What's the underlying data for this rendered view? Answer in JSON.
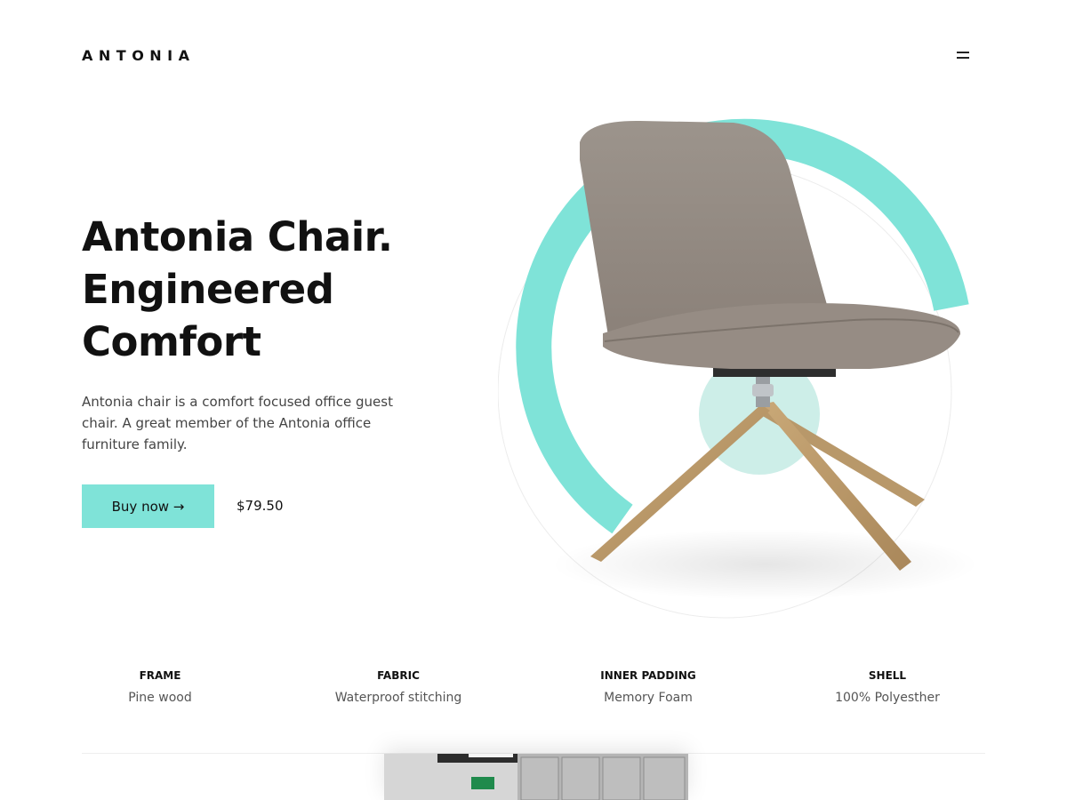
{
  "header": {
    "logo": "ANTONIA",
    "menu_icon": "hamburger-icon"
  },
  "hero": {
    "headline": [
      "Antonia Chair.",
      "Engineered",
      "Comfort"
    ],
    "description": "Antonia chair is a comfort focused office guest chair. A great member of the Antonia office furniture family.",
    "buy_label": "Buy now →",
    "price": "$79.50"
  },
  "specs": [
    {
      "title": "FRAME",
      "value": "Pine wood"
    },
    {
      "title": "FABRIC",
      "value": "Waterproof stitching"
    },
    {
      "title": "INNER PADDING",
      "value": "Memory Foam"
    },
    {
      "title": "SHELL",
      "value": "100% Polyesther"
    }
  ],
  "colors": {
    "accent": "#7fe3d8",
    "text": "#111111",
    "muted": "#555555"
  }
}
